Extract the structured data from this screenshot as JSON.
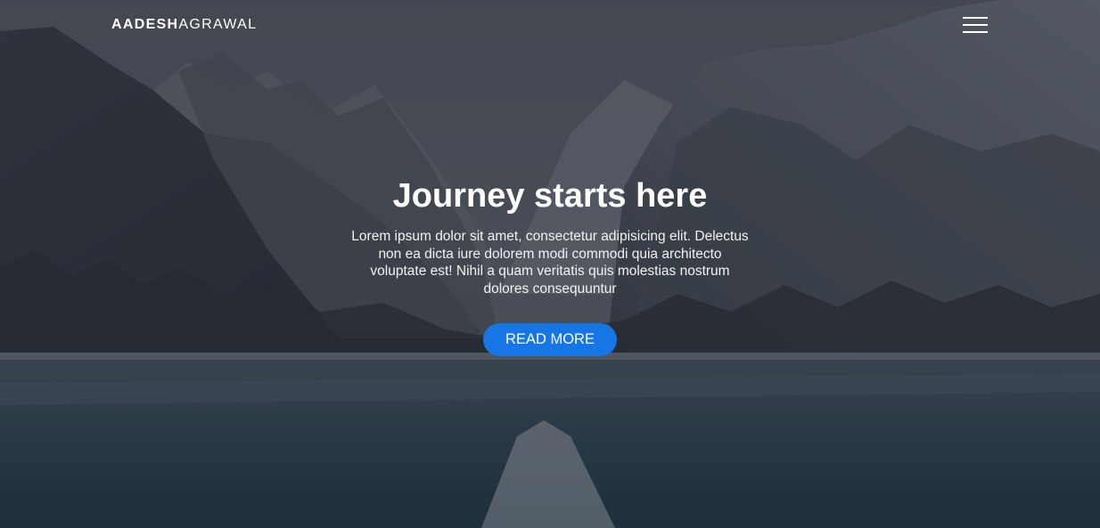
{
  "navbar": {
    "logo_bold": "AADESH",
    "logo_light": "AGRAWAL",
    "menu_icon": "hamburger-menu-icon"
  },
  "hero": {
    "title": "Journey starts here",
    "description": "Lorem ipsum dolor sit amet, consectetur adipisicing elit. Delectus non ea dicta iure dolorem modi commodi quia architecto voluptate est! Nihil a quam veritatis quis molestias nostrum dolores consequuntur",
    "button_label": "READ MORE"
  },
  "colors": {
    "accent": "#1676e6",
    "text": "#ffffff"
  }
}
